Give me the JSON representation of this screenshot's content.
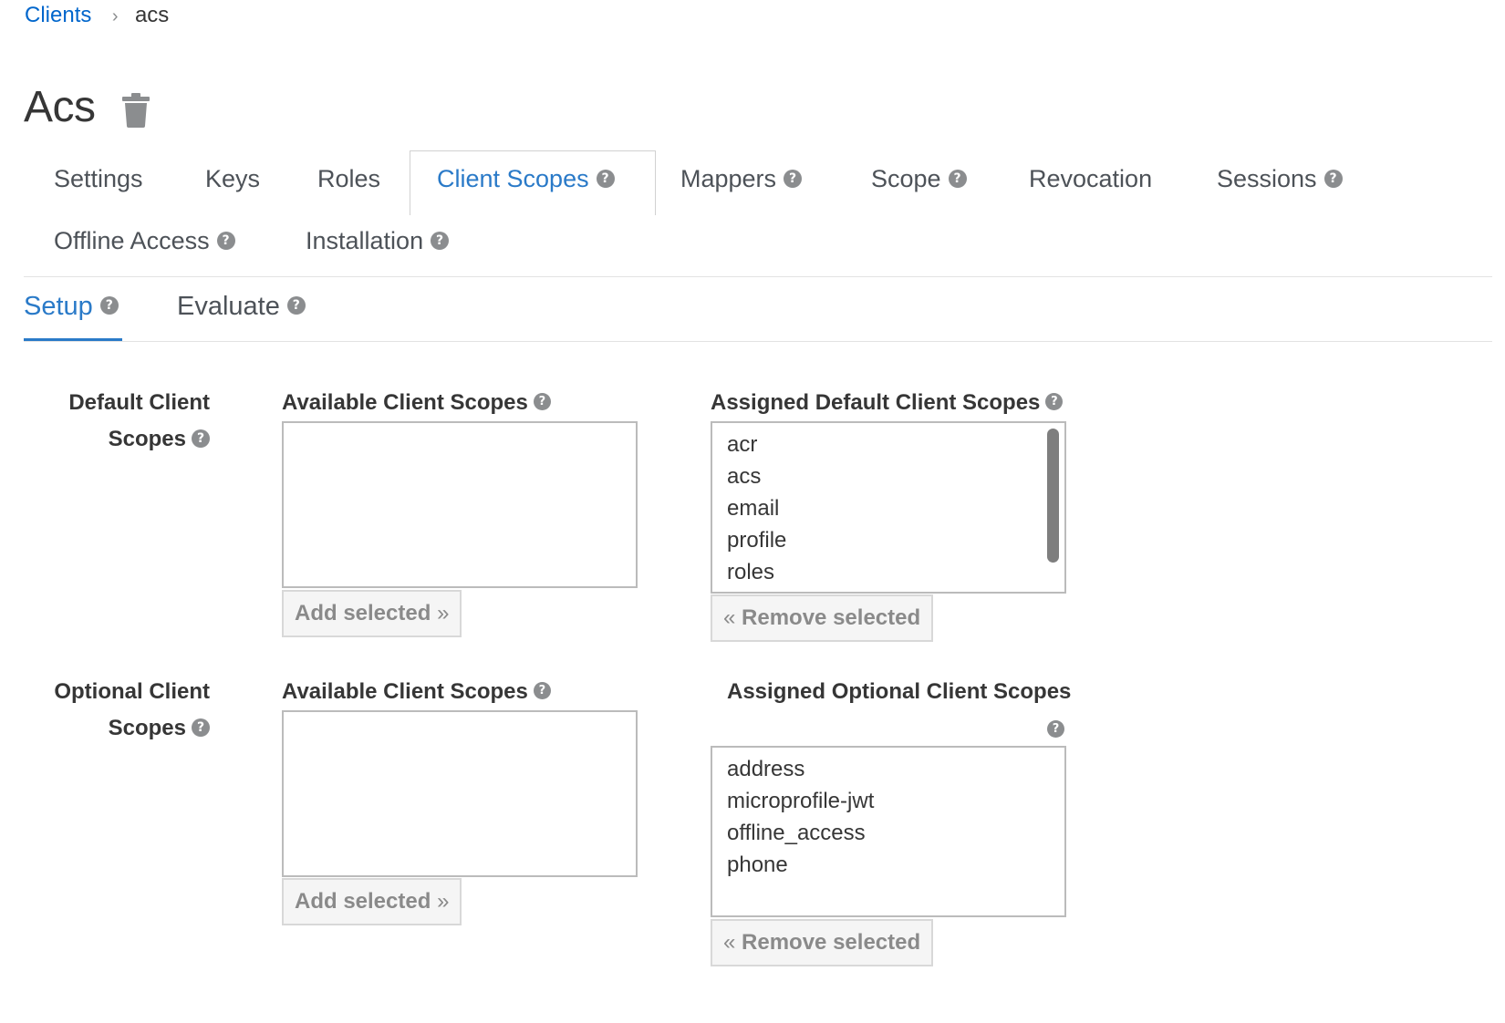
{
  "breadcrumb": {
    "parent": "Clients",
    "separator": "›",
    "current": "acs"
  },
  "page": {
    "title": "Acs",
    "delete_icon": "trash-icon"
  },
  "tabs": [
    {
      "label": "Settings",
      "help": false,
      "active": false
    },
    {
      "label": "Keys",
      "help": false,
      "active": false
    },
    {
      "label": "Roles",
      "help": false,
      "active": false
    },
    {
      "label": "Client Scopes",
      "help": true,
      "active": true
    },
    {
      "label": "Mappers",
      "help": true,
      "active": false
    },
    {
      "label": "Scope",
      "help": true,
      "active": false
    },
    {
      "label": "Revocation",
      "help": false,
      "active": false
    },
    {
      "label": "Sessions",
      "help": true,
      "active": false
    },
    {
      "label": "Offline Access",
      "help": true,
      "active": false
    },
    {
      "label": "Installation",
      "help": true,
      "active": false
    }
  ],
  "subtabs": [
    {
      "label": "Setup",
      "active": true
    },
    {
      "label": "Evaluate",
      "active": false
    }
  ],
  "help_glyph": "?",
  "default_section": {
    "label_line1": "Default Client",
    "label_line2": "Scopes",
    "available_label": "Available Client Scopes",
    "assigned_label": "Assigned Default Client Scopes",
    "available_items": [],
    "assigned_items": [
      "acr",
      "acs",
      "email",
      "profile",
      "roles"
    ],
    "add_button": "Add selected",
    "remove_button": "Remove selected"
  },
  "optional_section": {
    "label_line1": "Optional Client",
    "label_line2": "Scopes",
    "available_label": "Available Client Scopes",
    "assigned_label": "Assigned Optional Client Scopes",
    "available_items": [],
    "assigned_items": [
      "address",
      "microprofile-jwt",
      "offline_access",
      "phone"
    ],
    "add_button": "Add selected",
    "remove_button": "Remove selected"
  },
  "colors": {
    "link": "#0066cc",
    "active_tab": "#2a7ac8",
    "text": "#363636",
    "help_icon": "#8b8d8f"
  }
}
